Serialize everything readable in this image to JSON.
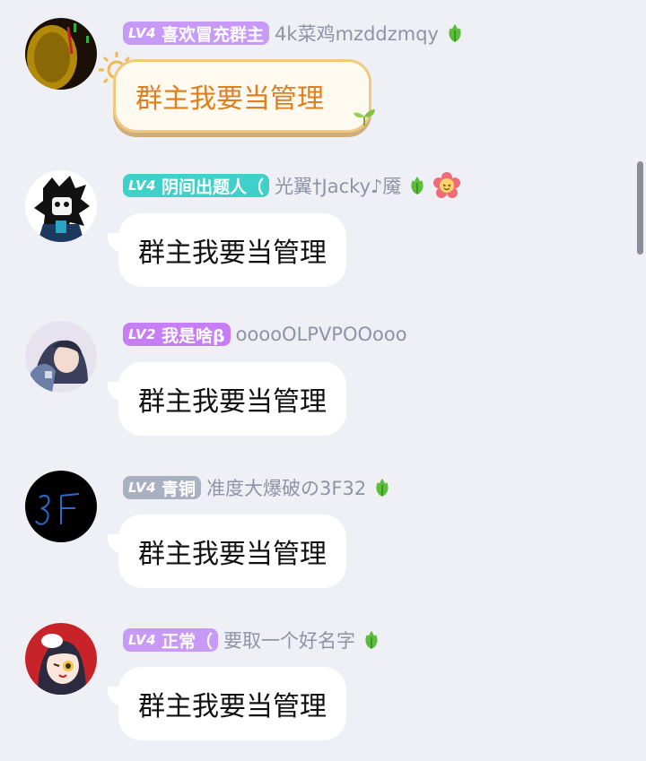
{
  "messages": [
    {
      "level": "LV4",
      "title": "喜欢冒充群主",
      "nickname": "4k菜鸡mzddzmqy",
      "badge_color": "#c79af7",
      "text": "群主我要当管理",
      "bubble_style": "fancy",
      "icons": [
        "leaf-icon"
      ]
    },
    {
      "level": "LV4",
      "title": "阴间出题人（",
      "nickname": "光翼†Jacky♪魇",
      "badge_color": "#3fd1c9",
      "text": "群主我要当管理",
      "bubble_style": "plain",
      "icons": [
        "leaf-icon",
        "flower-face-icon"
      ]
    },
    {
      "level": "LV2",
      "title": "我是啥β",
      "nickname": "ooooOLPVPOOooo",
      "badge_color": "#c77df5",
      "text": "群主我要当管理",
      "bubble_style": "plain",
      "icons": []
    },
    {
      "level": "LV4",
      "title": "青铜",
      "nickname": "准度大爆破の3F32",
      "badge_color": "#a9b0c2",
      "text": "群主我要当管理",
      "bubble_style": "plain",
      "icons": [
        "leaf-icon"
      ]
    },
    {
      "level": "LV4",
      "title": "正常（",
      "nickname": "要取一个好名字",
      "badge_color": "#c79af7",
      "text": "群主我要当管理",
      "bubble_style": "plain",
      "icons": [
        "leaf-icon"
      ]
    }
  ]
}
